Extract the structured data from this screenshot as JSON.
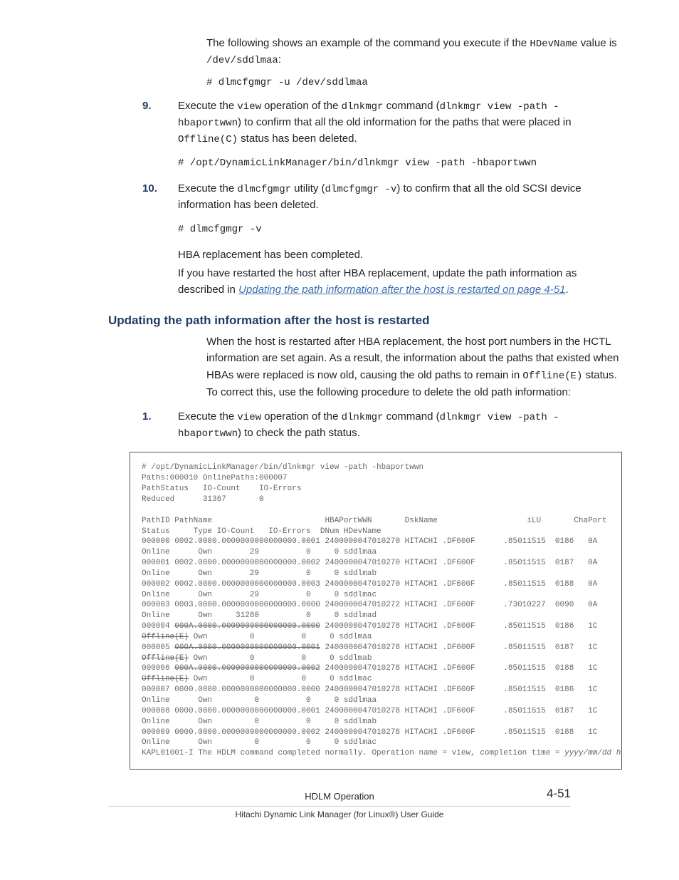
{
  "intro": {
    "line1_a": "The following shows an example of the command you execute if the",
    "hdev": "HDevName",
    "value_is": " value is ",
    "dev": "/dev/sddlmaa",
    "colon": ":"
  },
  "cmd_intro": "# dlmcfgmgr -u /dev/sddlmaa",
  "step9": {
    "t1": "Execute the ",
    "view": "view",
    "t2": " operation of the ",
    "dlnkmgr": "dlnkmgr",
    "t3": " command (",
    "cmd": "dlnkmgr view -path -hbaportwwn",
    "t4": ") to confirm that all the old information for the paths that were placed in ",
    "offline": "Offline(C)",
    "t5": " status has been deleted.",
    "code": "# /opt/DynamicLinkManager/bin/dlnkmgr view -path -hbaportwwn"
  },
  "step10": {
    "t1": "Execute the ",
    "util": "dlmcfgmgr",
    "t2": " utility (",
    "cmd": "dlmcfgmgr -v",
    "t3": ") to confirm that all the old SCSI device information has been deleted.",
    "code": "# dlmcfgmgr -v"
  },
  "after10": {
    "line1": "HBA replacement has been completed.",
    "line2a": "If you have restarted the host after HBA replacement, update the path information as described in ",
    "link": "Updating the path information after the host is restarted on page 4-51",
    "dot": "."
  },
  "heading": "Updating the path information after the host is restarted",
  "section": {
    "p1a": "When the host is restarted after HBA replacement, the host port numbers in the HCTL information are set again. As a result, the information about the paths that existed when HBAs were replaced is now old, causing the old paths to remain in ",
    "offline": "Offline(E)",
    "p1b": " status. To correct this, use the following procedure to delete the old path information:"
  },
  "sstep1": {
    "t1": "Execute the ",
    "view": "view",
    "t2": " operation of the ",
    "dlnkmgr": "dlnkmgr",
    "t3": " command (",
    "cmd": "dlnkmgr view -path -hbaportwwn",
    "t4": ") to check the path status."
  },
  "terminal": {
    "l1": "# /opt/DynamicLinkManager/bin/dlnkmgr view -path -hbaportwwn",
    "l2": "Paths:000010 OnlinePaths:000007",
    "l3": "PathStatus   IO-Count    IO-Errors",
    "l4": "Reduced      31367       0",
    "blank1": " ",
    "h1": "PathID PathName                        HBAPortWWN       DskName                   iLU       ChaPort",
    "h2": "Status     Type IO-Count   IO-Errors  DNum HDevName",
    "r0a": "000000 0002.0000.0000000000000000.0001 2400000047010270 HITACHI .DF600F      .85011515  0186   0A",
    "r0b": "Online      Own        29          0     0 sddlmaa",
    "r1a": "000001 0002.0000.0000000000000000.0002 2400000047010270 HITACHI .DF600F      .85011515  0187   0A",
    "r1b": "Online      Own        29          0     0 sddlmab",
    "r2a": "000002 0002.0000.0000000000000000.0003 2400000047010270 HITACHI .DF600F      .85011515  0188   0A",
    "r2b": "Online      Own        29          0     0 sddlmac",
    "r3a": "000003 0003.0000.0000000000000000.0000 2400000047010272 HITACHI .DF600F      .73010227  0090   0A",
    "r3b": "Online      Own     31280          0     0 sddlmad",
    "r4a_p": "000004 ",
    "r4a_s": "000A.0000.0000000000000000.0000",
    "r4a_t": " 2400000047010278 HITACHI .DF600F      .85011515  0186   1C",
    "r4b_s": "Offline(E)",
    "r4b_t": " Own         0          0     0 sddlmaa",
    "r5a_p": "000005 ",
    "r5a_s": "000A.0000.0000000000000000.0001",
    "r5a_t": " 2400000047010278 HITACHI .DF600F      .85011515  0187   1C",
    "r5b_s": "Offline(E)",
    "r5b_t": " Own         0          0     0 sddlmab",
    "r6a_p": "000006 ",
    "r6a_s": "000A.0000.0000000000000000.0002",
    "r6a_t": " 2400000047010278 HITACHI .DF600F      .85011515  0188   1C",
    "r6b_s": "Offline(E)",
    "r6b_t": " Own         0          0     0 sddlmac",
    "r7a": "000007 0000.0000.0000000000000000.0000 2400000047010278 HITACHI .DF600F      .85011515  0186   1C",
    "r7b": "Online      Own         0          0     0 sddlmaa",
    "r8a": "000008 0000.0000.0000000000000000.0001 2400000047010278 HITACHI .DF600F      .85011515  0187   1C",
    "r8b": "Online      Own         0          0     0 sddlmab",
    "r9a": "000009 0000.0000.0000000000000000.0002 2400000047010278 HITACHI .DF600F      .85011515  0188   1C",
    "r9b": "Online      Own         0          0     0 sddlmac",
    "msg_a": "KAPL01001-I The HDLM command completed normally. Operation name = view, completion time = ",
    "msg_b": "yyyy/mm/dd hh:mm:ss"
  },
  "footer": {
    "chapter": "HDLM Operation",
    "page": "4-51",
    "book": "Hitachi Dynamic Link Manager (for Linux®) User Guide"
  }
}
